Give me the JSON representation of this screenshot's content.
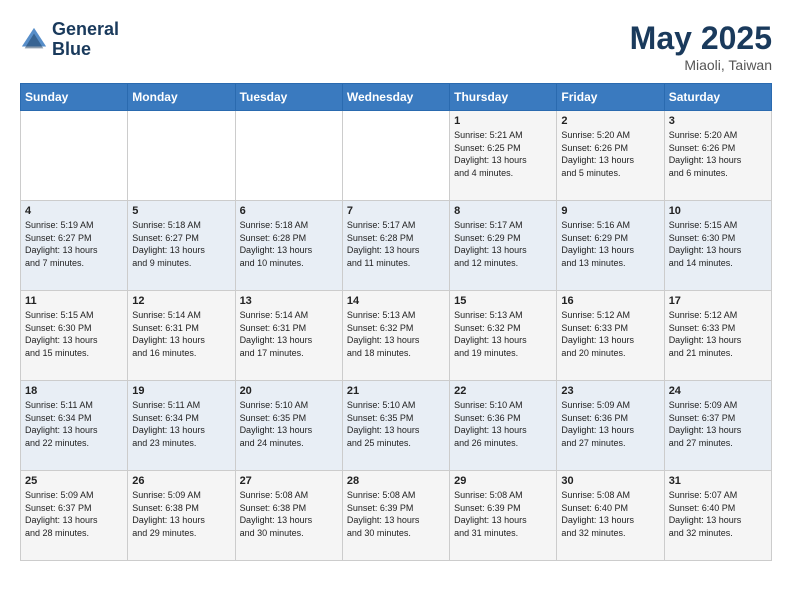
{
  "header": {
    "logo_line1": "General",
    "logo_line2": "Blue",
    "month": "May 2025",
    "location": "Miaoli, Taiwan"
  },
  "weekdays": [
    "Sunday",
    "Monday",
    "Tuesday",
    "Wednesday",
    "Thursday",
    "Friday",
    "Saturday"
  ],
  "weeks": [
    [
      {
        "day": "",
        "info": ""
      },
      {
        "day": "",
        "info": ""
      },
      {
        "day": "",
        "info": ""
      },
      {
        "day": "",
        "info": ""
      },
      {
        "day": "1",
        "info": "Sunrise: 5:21 AM\nSunset: 6:25 PM\nDaylight: 13 hours\nand 4 minutes."
      },
      {
        "day": "2",
        "info": "Sunrise: 5:20 AM\nSunset: 6:26 PM\nDaylight: 13 hours\nand 5 minutes."
      },
      {
        "day": "3",
        "info": "Sunrise: 5:20 AM\nSunset: 6:26 PM\nDaylight: 13 hours\nand 6 minutes."
      }
    ],
    [
      {
        "day": "4",
        "info": "Sunrise: 5:19 AM\nSunset: 6:27 PM\nDaylight: 13 hours\nand 7 minutes."
      },
      {
        "day": "5",
        "info": "Sunrise: 5:18 AM\nSunset: 6:27 PM\nDaylight: 13 hours\nand 9 minutes."
      },
      {
        "day": "6",
        "info": "Sunrise: 5:18 AM\nSunset: 6:28 PM\nDaylight: 13 hours\nand 10 minutes."
      },
      {
        "day": "7",
        "info": "Sunrise: 5:17 AM\nSunset: 6:28 PM\nDaylight: 13 hours\nand 11 minutes."
      },
      {
        "day": "8",
        "info": "Sunrise: 5:17 AM\nSunset: 6:29 PM\nDaylight: 13 hours\nand 12 minutes."
      },
      {
        "day": "9",
        "info": "Sunrise: 5:16 AM\nSunset: 6:29 PM\nDaylight: 13 hours\nand 13 minutes."
      },
      {
        "day": "10",
        "info": "Sunrise: 5:15 AM\nSunset: 6:30 PM\nDaylight: 13 hours\nand 14 minutes."
      }
    ],
    [
      {
        "day": "11",
        "info": "Sunrise: 5:15 AM\nSunset: 6:30 PM\nDaylight: 13 hours\nand 15 minutes."
      },
      {
        "day": "12",
        "info": "Sunrise: 5:14 AM\nSunset: 6:31 PM\nDaylight: 13 hours\nand 16 minutes."
      },
      {
        "day": "13",
        "info": "Sunrise: 5:14 AM\nSunset: 6:31 PM\nDaylight: 13 hours\nand 17 minutes."
      },
      {
        "day": "14",
        "info": "Sunrise: 5:13 AM\nSunset: 6:32 PM\nDaylight: 13 hours\nand 18 minutes."
      },
      {
        "day": "15",
        "info": "Sunrise: 5:13 AM\nSunset: 6:32 PM\nDaylight: 13 hours\nand 19 minutes."
      },
      {
        "day": "16",
        "info": "Sunrise: 5:12 AM\nSunset: 6:33 PM\nDaylight: 13 hours\nand 20 minutes."
      },
      {
        "day": "17",
        "info": "Sunrise: 5:12 AM\nSunset: 6:33 PM\nDaylight: 13 hours\nand 21 minutes."
      }
    ],
    [
      {
        "day": "18",
        "info": "Sunrise: 5:11 AM\nSunset: 6:34 PM\nDaylight: 13 hours\nand 22 minutes."
      },
      {
        "day": "19",
        "info": "Sunrise: 5:11 AM\nSunset: 6:34 PM\nDaylight: 13 hours\nand 23 minutes."
      },
      {
        "day": "20",
        "info": "Sunrise: 5:10 AM\nSunset: 6:35 PM\nDaylight: 13 hours\nand 24 minutes."
      },
      {
        "day": "21",
        "info": "Sunrise: 5:10 AM\nSunset: 6:35 PM\nDaylight: 13 hours\nand 25 minutes."
      },
      {
        "day": "22",
        "info": "Sunrise: 5:10 AM\nSunset: 6:36 PM\nDaylight: 13 hours\nand 26 minutes."
      },
      {
        "day": "23",
        "info": "Sunrise: 5:09 AM\nSunset: 6:36 PM\nDaylight: 13 hours\nand 27 minutes."
      },
      {
        "day": "24",
        "info": "Sunrise: 5:09 AM\nSunset: 6:37 PM\nDaylight: 13 hours\nand 27 minutes."
      }
    ],
    [
      {
        "day": "25",
        "info": "Sunrise: 5:09 AM\nSunset: 6:37 PM\nDaylight: 13 hours\nand 28 minutes."
      },
      {
        "day": "26",
        "info": "Sunrise: 5:09 AM\nSunset: 6:38 PM\nDaylight: 13 hours\nand 29 minutes."
      },
      {
        "day": "27",
        "info": "Sunrise: 5:08 AM\nSunset: 6:38 PM\nDaylight: 13 hours\nand 30 minutes."
      },
      {
        "day": "28",
        "info": "Sunrise: 5:08 AM\nSunset: 6:39 PM\nDaylight: 13 hours\nand 30 minutes."
      },
      {
        "day": "29",
        "info": "Sunrise: 5:08 AM\nSunset: 6:39 PM\nDaylight: 13 hours\nand 31 minutes."
      },
      {
        "day": "30",
        "info": "Sunrise: 5:08 AM\nSunset: 6:40 PM\nDaylight: 13 hours\nand 32 minutes."
      },
      {
        "day": "31",
        "info": "Sunrise: 5:07 AM\nSunset: 6:40 PM\nDaylight: 13 hours\nand 32 minutes."
      }
    ]
  ]
}
